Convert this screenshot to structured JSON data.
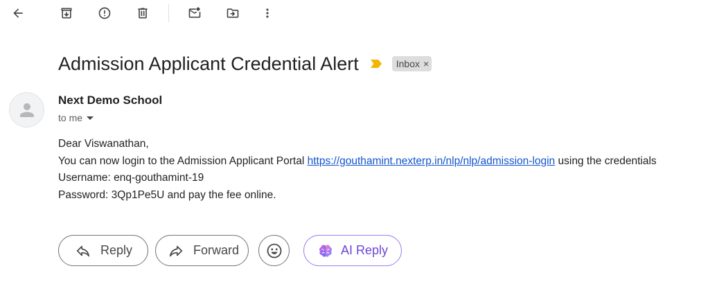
{
  "toolbar": {
    "icons": [
      "back-icon",
      "archive-icon",
      "report-spam-icon",
      "delete-icon",
      "mark-unread-icon",
      "move-to-icon",
      "more-icon"
    ]
  },
  "email": {
    "subject": "Admission Applicant Credential Alert",
    "label": "Inbox",
    "label_close": "×",
    "sender": "Next Demo School",
    "recipient": "to me",
    "body": {
      "greeting": "Dear Viswanathan,",
      "line1_prefix": "You can now login to the Admission Applicant Portal",
      "link": "https://gouthamint.nexterp.in/nlp/nlp/admission-login",
      "line1_suffix": "using the credentials",
      "username_line": "Username: enq-gouthamint-19",
      "password_line": "Password: 3Qp1Pe5U and pay the fee online."
    }
  },
  "actions": {
    "reply": "Reply",
    "forward": "Forward",
    "ai_reply": "AI Reply"
  },
  "colors": {
    "link": "#1155cc",
    "importance": "#f4b400",
    "ai_accent": "#7b4fe0"
  }
}
